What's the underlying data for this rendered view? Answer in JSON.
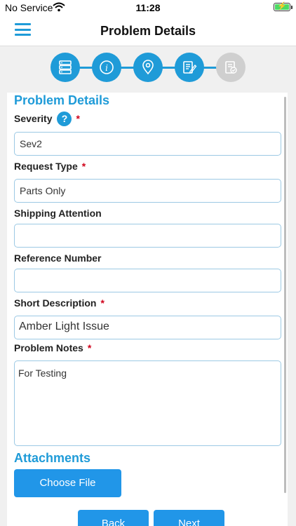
{
  "status_bar": {
    "carrier": "No Service",
    "time": "11:28"
  },
  "nav": {
    "title": "Problem Details"
  },
  "stepper": {
    "steps": [
      {
        "icon": "server-icon",
        "state": "complete"
      },
      {
        "icon": "info-icon",
        "state": "complete"
      },
      {
        "icon": "location-pin-icon",
        "state": "complete"
      },
      {
        "icon": "edit-document-icon",
        "state": "active"
      },
      {
        "icon": "document-check-icon",
        "state": "inactive"
      }
    ],
    "active_color": "#1f9bd8",
    "inactive_color": "#cfcfcf"
  },
  "form": {
    "section_title": "Problem Details",
    "severity": {
      "label": "Severity",
      "required_mark": "*",
      "help_glyph": "?",
      "value": "Sev2"
    },
    "request_type": {
      "label": "Request Type",
      "required_mark": "*",
      "value": "Parts Only"
    },
    "shipping_attention": {
      "label": "Shipping Attention",
      "value": ""
    },
    "reference_number": {
      "label": "Reference Number",
      "value": ""
    },
    "short_description": {
      "label": "Short Description",
      "required_mark": "*",
      "value": "Amber Light Issue"
    },
    "problem_notes": {
      "label": "Problem Notes",
      "required_mark": "*",
      "value": "For Testing"
    }
  },
  "attachments": {
    "title": "Attachments",
    "choose_file_label": "Choose File"
  },
  "footer": {
    "back_label": "Back",
    "next_label": "Next"
  },
  "colors": {
    "accent": "#1f9bd8",
    "button": "#2196e8",
    "required": "#d0021b"
  }
}
